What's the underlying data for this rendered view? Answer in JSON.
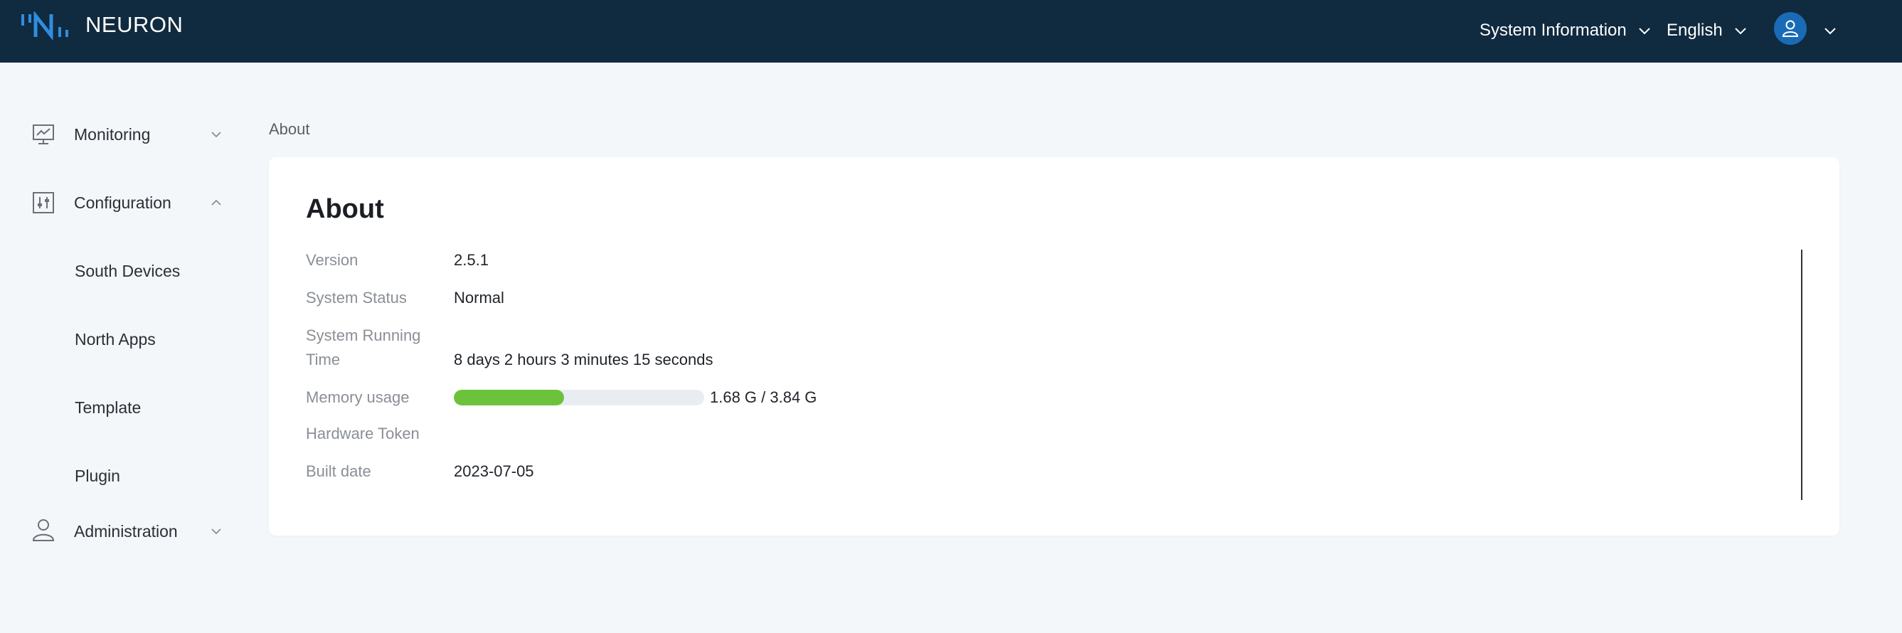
{
  "header": {
    "brand": "NEURON",
    "system_info_label": "System Information",
    "language_label": "English",
    "colors": {
      "background": "#102a3f",
      "logo_accent": "#2e8ee0",
      "avatar": "#1a6bb5"
    }
  },
  "sidebar": {
    "items": [
      {
        "label": "Monitoring",
        "icon": "monitor-chart-icon",
        "expanded": false
      },
      {
        "label": "Configuration",
        "icon": "sliders-icon",
        "expanded": true,
        "children": [
          "South Devices",
          "North Apps",
          "Template",
          "Plugin"
        ]
      },
      {
        "label": "Administration",
        "icon": "user-icon",
        "expanded": false
      }
    ]
  },
  "breadcrumb": "About",
  "about": {
    "title": "About",
    "rows": {
      "version": {
        "label": "Version",
        "value": "2.5.1"
      },
      "status": {
        "label": "System Status",
        "value": "Normal"
      },
      "running": {
        "label_line1": "System Running",
        "label_line2": "Time",
        "value": "8 days 2 hours 3 minutes 15 seconds"
      },
      "memory": {
        "label": "Memory usage",
        "value": "1.68 G / 3.84 G",
        "used_fraction": 0.44,
        "bar_color": "#6dc23c"
      },
      "token": {
        "label": "Hardware Token",
        "value": ""
      },
      "built": {
        "label": "Built date",
        "value": "2023-07-05"
      }
    }
  }
}
